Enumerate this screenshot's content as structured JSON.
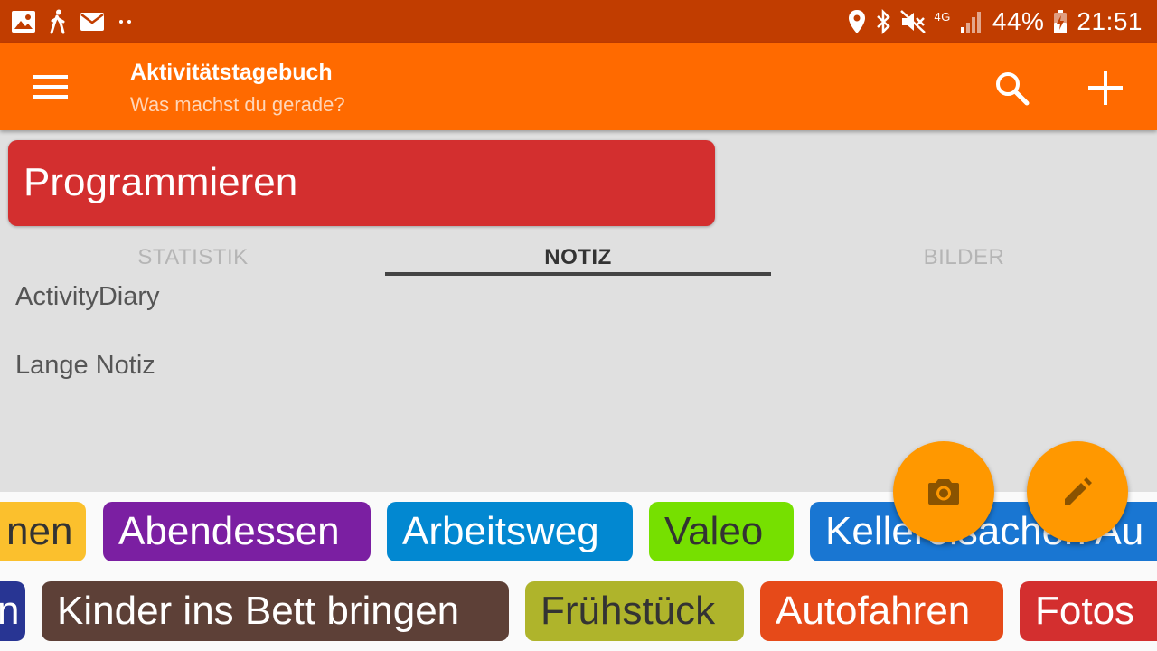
{
  "status_bar": {
    "battery": "44%",
    "time": "21:51",
    "network": "4G"
  },
  "app_bar": {
    "title": "Aktivitätstagebuch",
    "subtitle": "Was machst du gerade?"
  },
  "current_activity": {
    "name": "Programmieren",
    "color": "#d32f2f"
  },
  "tabs": [
    {
      "label": "STATISTIK",
      "active": false
    },
    {
      "label": "NOTIZ",
      "active": true
    },
    {
      "label": "BILDER",
      "active": false
    }
  ],
  "note": {
    "line1": "ActivityDiary",
    "line2": "Lange Notiz"
  },
  "activity_chips_row1": [
    {
      "label": "nen",
      "color": "#fbc02d",
      "text_color": "#333333"
    },
    {
      "label": "Abendessen",
      "color": "#7b1fa2",
      "text_color": "#ffffff"
    },
    {
      "label": "Arbeitsweg",
      "color": "#0288d1",
      "text_color": "#ffffff"
    },
    {
      "label": "Valeo",
      "color": "#76e000",
      "text_color": "#333333"
    },
    {
      "label": "Kellereisachen Au",
      "color": "#1976d2",
      "text_color": "#ffffff"
    }
  ],
  "activity_chips_row2": [
    {
      "label": "n",
      "color": "#283593",
      "text_color": "#ffffff"
    },
    {
      "label": "Kinder ins Bett bringen",
      "color": "#5d4037",
      "text_color": "#ffffff"
    },
    {
      "label": "Frühstück",
      "color": "#afb42b",
      "text_color": "#333333"
    },
    {
      "label": "Autofahren",
      "color": "#e64a19",
      "text_color": "#ffffff"
    },
    {
      "label": "Fotos",
      "color": "#d32f2f",
      "text_color": "#ffffff"
    }
  ],
  "icons": {
    "statusbar_left": [
      "image-icon",
      "walking-icon",
      "mail-icon",
      "more-dots-icon"
    ],
    "statusbar_right": [
      "location-icon",
      "bluetooth-icon",
      "mute-icon",
      "signal-icon",
      "battery-icon"
    ],
    "menu": "menu-icon",
    "search": "search-icon",
    "add": "add-icon",
    "camera_fab": "camera-icon",
    "edit_fab": "edit-icon"
  },
  "colors": {
    "status_bar": "#c13d00",
    "app_bar": "#ff6a00",
    "fab": "#ff9800",
    "background": "#e0e0e0"
  }
}
